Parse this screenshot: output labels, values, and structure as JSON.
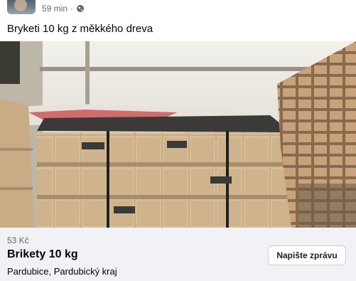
{
  "post": {
    "time": "59 min",
    "separator": "·",
    "audience_icon": "globe-icon",
    "text": "Bryketi 10 kg z měkkého dreva"
  },
  "listing": {
    "price": "53 Kč",
    "title": "Brikety 10 kg",
    "location": "Pardubice, Pardubický kraj",
    "message_button": "Napište zprávu"
  },
  "colors": {
    "secondary_text": "#65676b",
    "listing_bg": "#f0f2f5",
    "button_border": "#ced0d4"
  }
}
